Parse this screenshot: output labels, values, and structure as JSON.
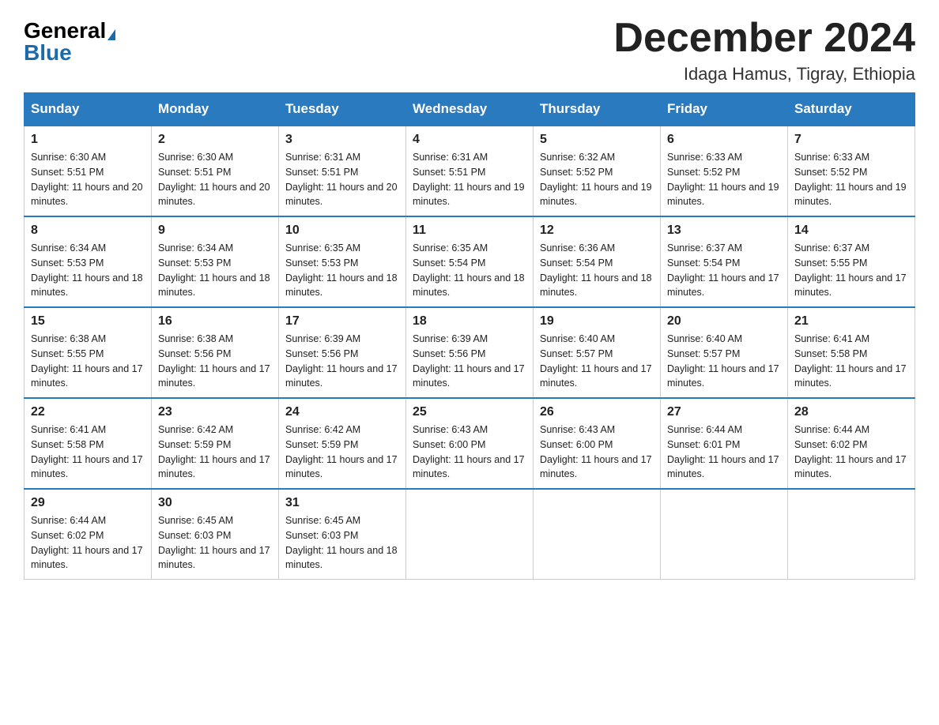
{
  "header": {
    "logo_general": "General",
    "logo_blue": "Blue",
    "month_year": "December 2024",
    "location": "Idaga Hamus, Tigray, Ethiopia"
  },
  "weekdays": [
    "Sunday",
    "Monday",
    "Tuesday",
    "Wednesday",
    "Thursday",
    "Friday",
    "Saturday"
  ],
  "weeks": [
    [
      {
        "day": "1",
        "sunrise": "6:30 AM",
        "sunset": "5:51 PM",
        "daylight": "11 hours and 20 minutes."
      },
      {
        "day": "2",
        "sunrise": "6:30 AM",
        "sunset": "5:51 PM",
        "daylight": "11 hours and 20 minutes."
      },
      {
        "day": "3",
        "sunrise": "6:31 AM",
        "sunset": "5:51 PM",
        "daylight": "11 hours and 20 minutes."
      },
      {
        "day": "4",
        "sunrise": "6:31 AM",
        "sunset": "5:51 PM",
        "daylight": "11 hours and 19 minutes."
      },
      {
        "day": "5",
        "sunrise": "6:32 AM",
        "sunset": "5:52 PM",
        "daylight": "11 hours and 19 minutes."
      },
      {
        "day": "6",
        "sunrise": "6:33 AM",
        "sunset": "5:52 PM",
        "daylight": "11 hours and 19 minutes."
      },
      {
        "day": "7",
        "sunrise": "6:33 AM",
        "sunset": "5:52 PM",
        "daylight": "11 hours and 19 minutes."
      }
    ],
    [
      {
        "day": "8",
        "sunrise": "6:34 AM",
        "sunset": "5:53 PM",
        "daylight": "11 hours and 18 minutes."
      },
      {
        "day": "9",
        "sunrise": "6:34 AM",
        "sunset": "5:53 PM",
        "daylight": "11 hours and 18 minutes."
      },
      {
        "day": "10",
        "sunrise": "6:35 AM",
        "sunset": "5:53 PM",
        "daylight": "11 hours and 18 minutes."
      },
      {
        "day": "11",
        "sunrise": "6:35 AM",
        "sunset": "5:54 PM",
        "daylight": "11 hours and 18 minutes."
      },
      {
        "day": "12",
        "sunrise": "6:36 AM",
        "sunset": "5:54 PM",
        "daylight": "11 hours and 18 minutes."
      },
      {
        "day": "13",
        "sunrise": "6:37 AM",
        "sunset": "5:54 PM",
        "daylight": "11 hours and 17 minutes."
      },
      {
        "day": "14",
        "sunrise": "6:37 AM",
        "sunset": "5:55 PM",
        "daylight": "11 hours and 17 minutes."
      }
    ],
    [
      {
        "day": "15",
        "sunrise": "6:38 AM",
        "sunset": "5:55 PM",
        "daylight": "11 hours and 17 minutes."
      },
      {
        "day": "16",
        "sunrise": "6:38 AM",
        "sunset": "5:56 PM",
        "daylight": "11 hours and 17 minutes."
      },
      {
        "day": "17",
        "sunrise": "6:39 AM",
        "sunset": "5:56 PM",
        "daylight": "11 hours and 17 minutes."
      },
      {
        "day": "18",
        "sunrise": "6:39 AM",
        "sunset": "5:56 PM",
        "daylight": "11 hours and 17 minutes."
      },
      {
        "day": "19",
        "sunrise": "6:40 AM",
        "sunset": "5:57 PM",
        "daylight": "11 hours and 17 minutes."
      },
      {
        "day": "20",
        "sunrise": "6:40 AM",
        "sunset": "5:57 PM",
        "daylight": "11 hours and 17 minutes."
      },
      {
        "day": "21",
        "sunrise": "6:41 AM",
        "sunset": "5:58 PM",
        "daylight": "11 hours and 17 minutes."
      }
    ],
    [
      {
        "day": "22",
        "sunrise": "6:41 AM",
        "sunset": "5:58 PM",
        "daylight": "11 hours and 17 minutes."
      },
      {
        "day": "23",
        "sunrise": "6:42 AM",
        "sunset": "5:59 PM",
        "daylight": "11 hours and 17 minutes."
      },
      {
        "day": "24",
        "sunrise": "6:42 AM",
        "sunset": "5:59 PM",
        "daylight": "11 hours and 17 minutes."
      },
      {
        "day": "25",
        "sunrise": "6:43 AM",
        "sunset": "6:00 PM",
        "daylight": "11 hours and 17 minutes."
      },
      {
        "day": "26",
        "sunrise": "6:43 AM",
        "sunset": "6:00 PM",
        "daylight": "11 hours and 17 minutes."
      },
      {
        "day": "27",
        "sunrise": "6:44 AM",
        "sunset": "6:01 PM",
        "daylight": "11 hours and 17 minutes."
      },
      {
        "day": "28",
        "sunrise": "6:44 AM",
        "sunset": "6:02 PM",
        "daylight": "11 hours and 17 minutes."
      }
    ],
    [
      {
        "day": "29",
        "sunrise": "6:44 AM",
        "sunset": "6:02 PM",
        "daylight": "11 hours and 17 minutes."
      },
      {
        "day": "30",
        "sunrise": "6:45 AM",
        "sunset": "6:03 PM",
        "daylight": "11 hours and 17 minutes."
      },
      {
        "day": "31",
        "sunrise": "6:45 AM",
        "sunset": "6:03 PM",
        "daylight": "11 hours and 18 minutes."
      },
      null,
      null,
      null,
      null
    ]
  ],
  "labels": {
    "sunrise": "Sunrise: ",
    "sunset": "Sunset: ",
    "daylight": "Daylight: "
  }
}
